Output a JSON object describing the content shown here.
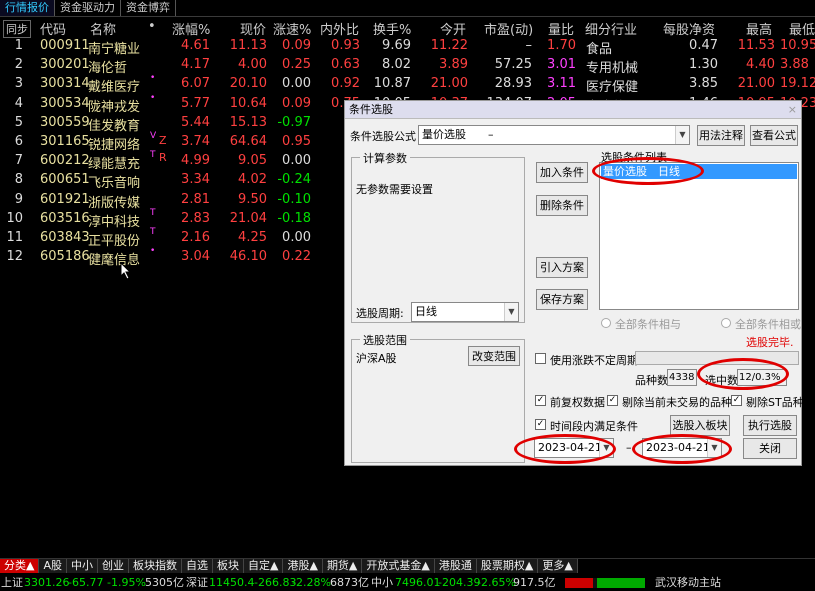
{
  "top_tabs": [
    "行情报价",
    "资金驱动力",
    "资金博弈"
  ],
  "header": {
    "sync": "同步",
    "code": "代码",
    "name": "名称",
    "dot": "•",
    "change_pct": "涨幅%",
    "price": "现价",
    "speed": "涨速%",
    "ratio": "内外比",
    "turnover": "换手%",
    "open": "今开",
    "pe": "市盈(动)",
    "vol_ratio": "量比",
    "industry": "细分行业",
    "nav": "每股净资",
    "high": "最高",
    "low": "最低"
  },
  "rows": [
    {
      "idx": "1",
      "code": "000911",
      "name": "南宁糖业",
      "mark": "",
      "chg": "4.61",
      "price": "11.13",
      "speed": "0.09",
      "ratio": "0.93",
      "turnover": "9.69",
      "open": "11.22",
      "pe": "–",
      "vr": "1.70",
      "ind": "食品",
      "nav": "0.47",
      "high": "11.53",
      "low": "10.95"
    },
    {
      "idx": "2",
      "code": "300201",
      "name": "海伦哲",
      "mark": "",
      "chg": "4.17",
      "price": "4.00",
      "speed": "0.25",
      "ratio": "0.63",
      "turnover": "8.02",
      "open": "3.89",
      "pe": "57.25",
      "vr": "3.01",
      "ind": "专用机械",
      "nav": "1.30",
      "high": "4.40",
      "low": "3.88"
    },
    {
      "idx": "3",
      "code": "300314",
      "name": "戴维医疗",
      "mark": "•",
      "chg": "6.07",
      "price": "20.10",
      "speed": "0.00",
      "ratio": "0.92",
      "turnover": "10.87",
      "open": "21.00",
      "pe": "28.93",
      "vr": "3.11",
      "ind": "医疗保健",
      "nav": "3.85",
      "high": "21.00",
      "low": "19.12"
    },
    {
      "idx": "4",
      "code": "300534",
      "name": "陇神戎发",
      "mark": "•",
      "chg": "5.77",
      "price": "10.64",
      "speed": "0.09",
      "ratio": "0.75",
      "turnover": "10.05",
      "open": "10.37",
      "pe": "134.07",
      "vr": "2.05",
      "ind": "中成药",
      "nav": "1.46",
      "high": "10.95",
      "low": "10.23"
    },
    {
      "idx": "5",
      "code": "300559",
      "name": "佳发教育",
      "mark": "",
      "chg": "5.44",
      "price": "15.13",
      "speed": "-0.97",
      "ratio": "",
      "turnover": "",
      "open": "",
      "pe": "",
      "vr": "",
      "ind": "",
      "nav": "",
      "high": "",
      "low": "15"
    },
    {
      "idx": "6",
      "code": "301165",
      "name": "锐捷网络",
      "mark": "V",
      "chg": "3.74",
      "price": "64.64",
      "speed": "0.95",
      "ratio": "",
      "turnover": "",
      "open": "",
      "pe": "",
      "vr": "",
      "ind": "",
      "nav": "",
      "high": "",
      "low": "62"
    },
    {
      "idx": "7",
      "code": "600212",
      "name": "绿能慧充",
      "mark": "T",
      "chg": "4.99",
      "price": "9.05",
      "speed": "0.00",
      "ratio": "",
      "turnover": "",
      "open": "",
      "pe": "",
      "vr": "",
      "ind": "",
      "nav": "",
      "high": "",
      "low": "8"
    },
    {
      "idx": "8",
      "code": "600651",
      "name": "飞乐音响",
      "mark": "",
      "chg": "3.34",
      "price": "4.02",
      "speed": "-0.24",
      "ratio": "",
      "turnover": "",
      "open": "",
      "pe": "",
      "vr": "",
      "ind": "",
      "nav": "",
      "high": "",
      "low": "3"
    },
    {
      "idx": "9",
      "code": "601921",
      "name": "浙版传媒",
      "mark": "",
      "chg": "2.81",
      "price": "9.50",
      "speed": "-0.10",
      "ratio": "",
      "turnover": "",
      "open": "",
      "pe": "",
      "vr": "",
      "ind": "",
      "nav": "",
      "high": "",
      "low": "9"
    },
    {
      "idx": "10",
      "code": "603516",
      "name": "淳中科技",
      "mark": "T",
      "chg": "2.83",
      "price": "21.04",
      "speed": "-0.18",
      "ratio": "",
      "turnover": "",
      "open": "",
      "pe": "",
      "vr": "",
      "ind": "",
      "nav": "",
      "high": "",
      "low": "20"
    },
    {
      "idx": "11",
      "code": "603843",
      "name": "正平股份",
      "mark": "T",
      "chg": "2.16",
      "price": "4.25",
      "speed": "0.00",
      "ratio": "",
      "turnover": "",
      "open": "",
      "pe": "",
      "vr": "",
      "ind": "",
      "nav": "",
      "high": "",
      "low": "4"
    },
    {
      "idx": "12",
      "code": "605186",
      "name": "健麾信息",
      "mark": "•",
      "chg": "3.04",
      "price": "46.10",
      "speed": "0.22",
      "ratio": "",
      "turnover": "",
      "open": "",
      "pe": "",
      "vr": "",
      "ind": "",
      "nav": "",
      "high": "",
      "low": "43"
    }
  ],
  "side_marks": {
    "z": "Z",
    "r": "R"
  },
  "dialog": {
    "title": "条件选股",
    "close": "×",
    "formula_label": "条件选股公式",
    "formula_value": "量价选股　　–",
    "usage_btn": "用法注释",
    "view_btn": "查看公式",
    "calc_group": "计算参数",
    "no_param": "无参数需要设置",
    "add_btn": "加入条件",
    "del_btn": "删除条件",
    "import_btn": "引入方案",
    "save_btn": "保存方案",
    "list_label": "选股条件列表",
    "list_item": "量价选股　日线",
    "period_label": "选股周期:",
    "period_value": "日线",
    "all_and": "全部条件相与",
    "all_or": "全部条件相或",
    "done": "选股完毕.",
    "range_group": "选股范围",
    "range_value": "沪深A股",
    "change_range_btn": "改变范围",
    "use_limit": "使用涨跌不定周期",
    "count_label": "品种数",
    "count_value": "4338",
    "selected_label": "选中数",
    "selected_value": "12/0.3%",
    "pre_rights": "前复权数据",
    "remove_untraded": "剔除当前未交易的品种",
    "remove_st": "剔除ST品种",
    "time_cond": "时间段内满足条件",
    "to_block_btn": "选股入板块",
    "run_btn": "执行选股",
    "date_from": "2023-04-21",
    "dash": "–",
    "date_to": "2023-04-21",
    "close_btn": "关闭"
  },
  "bottom_tabs": [
    "分类▲",
    "A股",
    "中小",
    "创业",
    "板块指数",
    "自选",
    "板块",
    "自定▲",
    "港股▲",
    "期货▲",
    "开放式基金▲",
    "港股通",
    "股票期权▲",
    "更多▲"
  ],
  "status": {
    "sh_name": "上证",
    "sh_val": "3301.26",
    "sh_chg": "-65.77",
    "sh_pct": "-1.95%",
    "sh_amt": "5305亿",
    "sz_name": "深证",
    "sz_val": "11450.4",
    "sz_chg": "-266.83",
    "sz_pct": "-2.28%",
    "sz_amt": "6873亿",
    "zx_name": "中小",
    "zx_val": "7496.01",
    "zx_chg": "-204.39",
    "zx_pct": "-2.65%",
    "zx_amt": "917.5亿",
    "server": "武汉移动主站"
  },
  "colors": {
    "up": "#ff4040",
    "down": "#00e000",
    "accent": "#3cf",
    "highlight": "#e00000"
  }
}
